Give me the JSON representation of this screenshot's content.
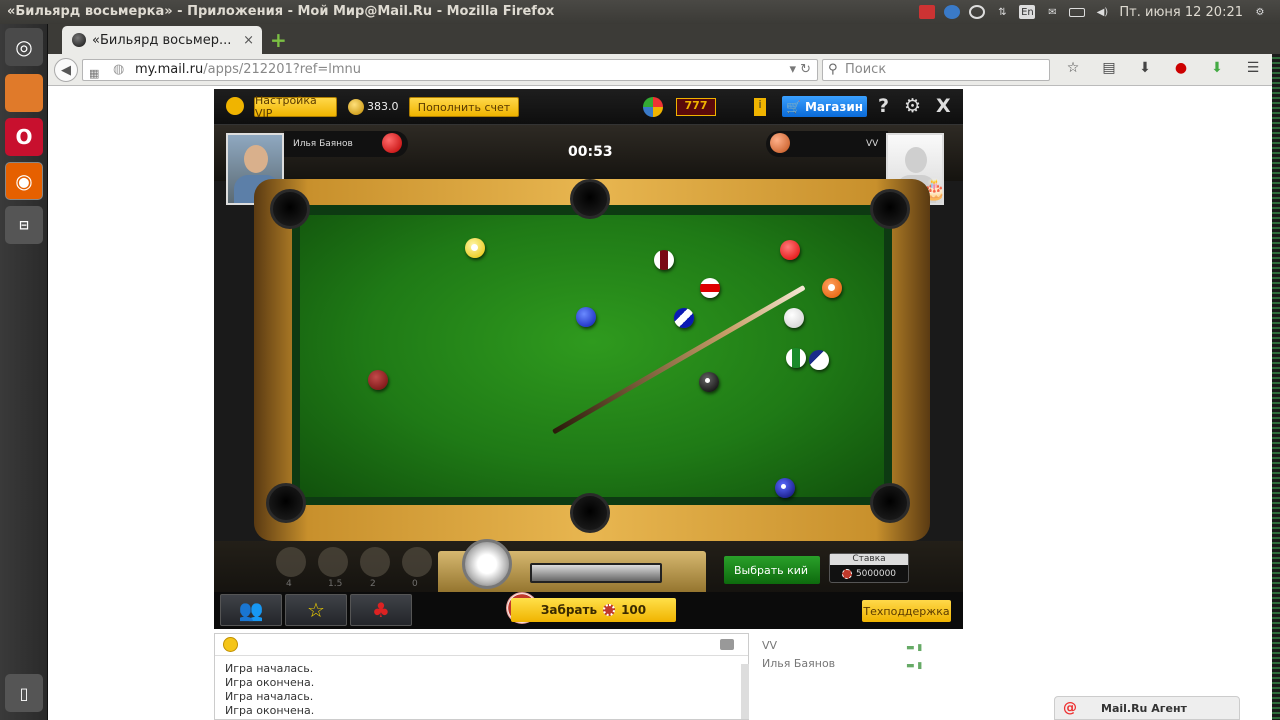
{
  "window": {
    "title": "«Бильярд восьмерка» - Приложения - Мой Мир@Mail.Ru - Mozilla Firefox"
  },
  "tray": {
    "keyboard": "En",
    "clock": "Пт. июня 12 20:21"
  },
  "tab": {
    "label": "«Бильярд восьмер...",
    "close": "×",
    "new": "+"
  },
  "urlbar": {
    "host": "my.mail.ru",
    "path": "/apps/212201?ref=lmnu",
    "prefix": "my."
  },
  "search": {
    "placeholder": "Поиск"
  },
  "game_header": {
    "vip_label": "Настройка VIP",
    "balance": "383.0",
    "topup_label": "Пополнить счет",
    "slots": "777",
    "shop_label": "Магазин",
    "help": "?",
    "close": "X"
  },
  "players": {
    "left_name": "Илья Баянов",
    "right_name": "VV"
  },
  "timer": "00:53",
  "controls": {
    "pick_cue": "Выбрать кий",
    "stake_label": "Ставка",
    "stake_value": "5000000",
    "tool_counts": [
      "4",
      "1.5",
      "2",
      "0"
    ]
  },
  "footer": {
    "collect_label": "Забрать",
    "collect_amount": "100",
    "support_label": "Техподдержка"
  },
  "chat": {
    "messages": [
      "Игра началась.",
      "Игра окончена.",
      "Игра началась.",
      "Игра окончена."
    ]
  },
  "player_list": [
    "VV",
    "Илья Баянов"
  ],
  "agent": {
    "label": "Mail.Ru Агент"
  },
  "colors": {
    "felt": "#1f7a16",
    "accent_yellow": "#f0b400",
    "shop_blue": "#0a6ad8"
  }
}
